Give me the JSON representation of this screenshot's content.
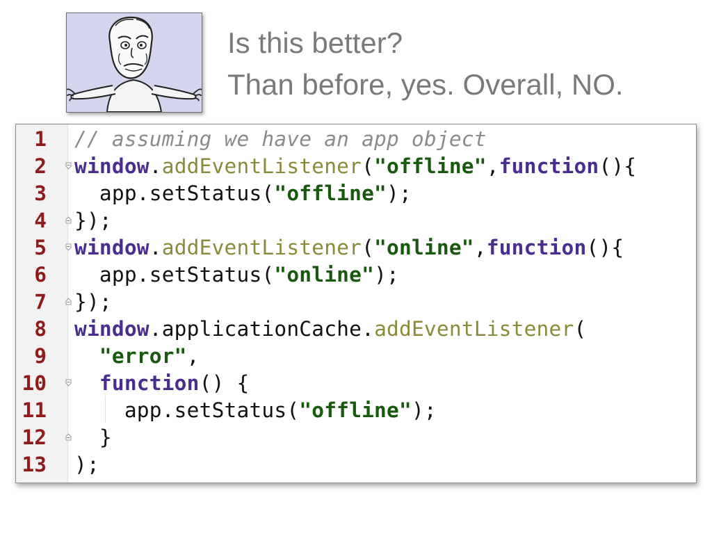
{
  "heading": {
    "question": "Is this better?",
    "answer": "Than before, yes. Overall, NO."
  },
  "image": {
    "depicts": "shrugging-meme-face"
  },
  "colors": {
    "line_number": "#8f1b1b",
    "keyword": "#4a2d8f",
    "string": "#19590f",
    "method": "#8a8a3b",
    "comment": "#8b8b8b",
    "text": "#111111",
    "caption": "#7a7a7a"
  },
  "code": {
    "lines": [
      {
        "number": "1",
        "fold": "none",
        "tokens": [
          {
            "t": "// assuming we have an app object",
            "k": "comment"
          }
        ]
      },
      {
        "number": "2",
        "fold": "open",
        "tokens": [
          {
            "t": "window",
            "k": "kw"
          },
          {
            "t": ".",
            "k": "plain"
          },
          {
            "t": "addEventListener",
            "k": "method"
          },
          {
            "t": "(",
            "k": "plain"
          },
          {
            "t": "\"offline\"",
            "k": "str"
          },
          {
            "t": ",",
            "k": "plain"
          },
          {
            "t": "function",
            "k": "kw"
          },
          {
            "t": "(){",
            "k": "plain"
          }
        ]
      },
      {
        "number": "3",
        "fold": "none",
        "tokens": [
          {
            "t": "  app.setStatus(",
            "k": "plain"
          },
          {
            "t": "\"offline\"",
            "k": "str"
          },
          {
            "t": ");",
            "k": "plain"
          }
        ]
      },
      {
        "number": "4",
        "fold": "close",
        "tokens": [
          {
            "t": "});",
            "k": "plain"
          }
        ]
      },
      {
        "number": "5",
        "fold": "open",
        "tokens": [
          {
            "t": "window",
            "k": "kw"
          },
          {
            "t": ".",
            "k": "plain"
          },
          {
            "t": "addEventListener",
            "k": "method"
          },
          {
            "t": "(",
            "k": "plain"
          },
          {
            "t": "\"online\"",
            "k": "str"
          },
          {
            "t": ",",
            "k": "plain"
          },
          {
            "t": "function",
            "k": "kw"
          },
          {
            "t": "(){",
            "k": "plain"
          }
        ]
      },
      {
        "number": "6",
        "fold": "none",
        "tokens": [
          {
            "t": "  app.setStatus(",
            "k": "plain"
          },
          {
            "t": "\"online\"",
            "k": "str"
          },
          {
            "t": ");",
            "k": "plain"
          }
        ]
      },
      {
        "number": "7",
        "fold": "close",
        "tokens": [
          {
            "t": "});",
            "k": "plain"
          }
        ]
      },
      {
        "number": "8",
        "fold": "none",
        "tokens": [
          {
            "t": "window",
            "k": "kw"
          },
          {
            "t": ".applicationCache.",
            "k": "plain"
          },
          {
            "t": "addEventListener",
            "k": "method"
          },
          {
            "t": "(",
            "k": "plain"
          }
        ]
      },
      {
        "number": "9",
        "fold": "none",
        "tokens": [
          {
            "t": "  ",
            "k": "plain"
          },
          {
            "t": "\"error\"",
            "k": "str"
          },
          {
            "t": ",",
            "k": "plain"
          }
        ]
      },
      {
        "number": "10",
        "fold": "open",
        "tokens": [
          {
            "t": "  ",
            "k": "plain"
          },
          {
            "t": "function",
            "k": "kw"
          },
          {
            "t": "() {",
            "k": "plain"
          }
        ]
      },
      {
        "number": "11",
        "fold": "none",
        "tokens": [
          {
            "t": "    app.setStatus(",
            "k": "plain"
          },
          {
            "t": "\"offline\"",
            "k": "str"
          },
          {
            "t": ");",
            "k": "plain"
          }
        ]
      },
      {
        "number": "12",
        "fold": "close",
        "tokens": [
          {
            "t": "  }",
            "k": "plain"
          }
        ]
      },
      {
        "number": "13",
        "fold": "none",
        "tokens": [
          {
            "t": ");",
            "k": "plain"
          }
        ]
      }
    ]
  }
}
